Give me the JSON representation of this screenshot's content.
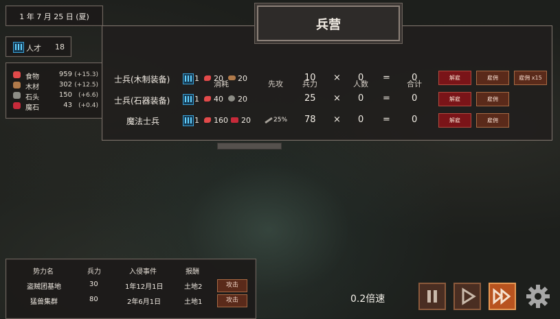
{
  "date": {
    "text": "1 年    7 月  25 日 (夏)"
  },
  "talent": {
    "label": "人才",
    "value": "18",
    "icon": "talent-icon"
  },
  "resources": [
    {
      "name": "食物",
      "amount": "959",
      "rate": "(+15.3)",
      "icon": "meat-icon",
      "color": "#e24a4a"
    },
    {
      "name": "木材",
      "amount": "302",
      "rate": "(+12.5)",
      "icon": "wood-icon",
      "color": "#b17a4a"
    },
    {
      "name": "石头",
      "amount": "150",
      "rate": "(+6.6)",
      "icon": "stone-icon",
      "color": "#8d8d86"
    },
    {
      "name": "魔石",
      "amount": "43",
      "rate": "(+0.4)",
      "icon": "magic-stone-icon",
      "color": "#c72a3a"
    }
  ],
  "barracks": {
    "title": "兵营",
    "headers": {
      "cost": "消耗",
      "first_strike": "先攻",
      "power": "兵力",
      "count": "人数",
      "total": "合计"
    },
    "units": [
      {
        "name": "士兵(木制装备)",
        "cost": {
          "talent": "1",
          "food": "20",
          "third": "20",
          "third_icon": "wood-icon"
        },
        "first_strike": "",
        "power": "10",
        "times": "×",
        "count": "0",
        "eq": "=",
        "total": "0",
        "buttons": {
          "dismiss": "解雇",
          "hire": "雇佣",
          "hire15": "雇佣 x15"
        }
      },
      {
        "name": "士兵(石器装备)",
        "cost": {
          "talent": "1",
          "food": "40",
          "third": "20",
          "third_icon": "stone-icon"
        },
        "first_strike": "",
        "power": "25",
        "times": "×",
        "count": "0",
        "eq": "=",
        "total": "0",
        "buttons": {
          "dismiss": "解雇",
          "hire": "雇佣"
        }
      },
      {
        "name": "魔法士兵",
        "cost": {
          "talent": "1",
          "food": "160",
          "third": "20",
          "third_icon": "magic-stone-icon"
        },
        "first_strike": "25%",
        "power": "78",
        "times": "×",
        "count": "0",
        "eq": "=",
        "total": "0",
        "buttons": {
          "dismiss": "解雇",
          "hire": "雇佣"
        }
      }
    ]
  },
  "enemies": {
    "headers": {
      "name": "势力名",
      "power": "兵力",
      "event": "入侵事件",
      "reward": "报酬"
    },
    "rows": [
      {
        "name": "盗贼团基地",
        "power": "30",
        "event": "1年12月1日",
        "reward": "土地2",
        "action": "攻击"
      },
      {
        "name": "猛兽集群",
        "power": "80",
        "event": "2年6月1日",
        "reward": "土地1",
        "action": "攻击"
      }
    ]
  },
  "speed": {
    "label": "0.2倍速"
  },
  "colors": {
    "accent_orange": "#b8531f",
    "button_red": "#7a1418",
    "talent_blue": "#3aa2d8"
  }
}
